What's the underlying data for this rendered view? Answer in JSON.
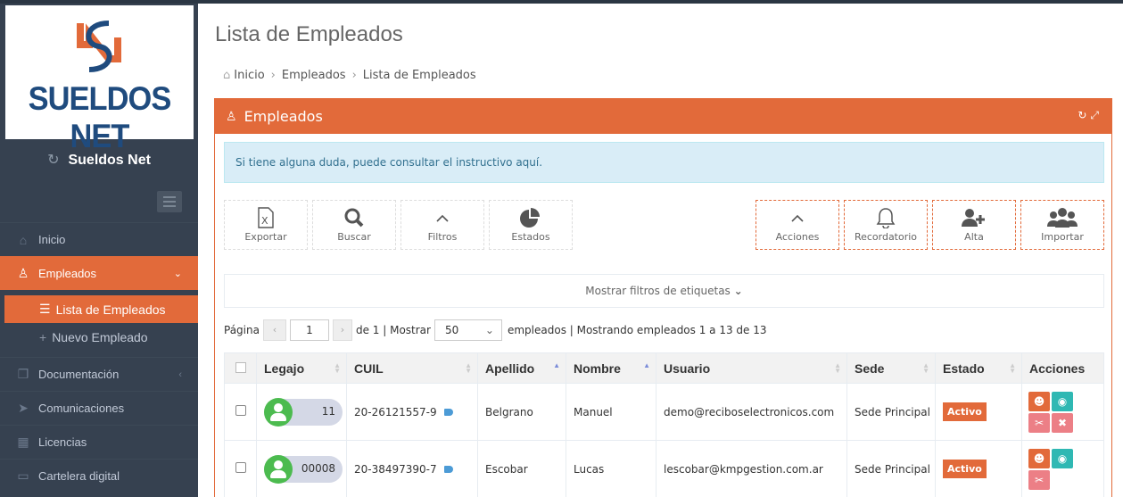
{
  "brand": {
    "logo_text": "SUELDOS NET",
    "app_name": "Sueldos Net"
  },
  "sidebar": {
    "items": [
      {
        "label": "Inicio",
        "icon": "home-icon"
      },
      {
        "label": "Empleados",
        "icon": "employees-icon"
      },
      {
        "label": "Documentación",
        "icon": "document-icon"
      },
      {
        "label": "Comunicaciones",
        "icon": "send-icon"
      },
      {
        "label": "Licencias",
        "icon": "calendar-icon"
      },
      {
        "label": "Cartelera digital",
        "icon": "board-icon"
      }
    ],
    "subitems": [
      {
        "label": "Lista de Empleados",
        "icon": "list-icon"
      },
      {
        "label": "Nuevo Empleado",
        "icon": "plus-icon"
      }
    ]
  },
  "page": {
    "title": "Lista de Empleados",
    "breadcrumb": [
      "Inicio",
      "Empleados",
      "Lista de Empleados"
    ]
  },
  "panel": {
    "title": "Empleados",
    "info": "Si tiene alguna duda, puede consultar el instructivo aquí.",
    "toolbar": [
      "Exportar",
      "Buscar",
      "Filtros",
      "Estados"
    ],
    "toolbar_right": [
      "Acciones",
      "Recordatorio",
      "Alta",
      "Importar"
    ],
    "tag_filter": "Mostrar filtros de etiquetas"
  },
  "pager": {
    "prefix": "Página",
    "page": "1",
    "of_text": "de 1 | Mostrar",
    "page_size": "50",
    "suffix": "empleados | Mostrando empleados 1 a 13 de 13"
  },
  "table": {
    "headers": [
      "Legajo",
      "CUIL",
      "Apellido",
      "Nombre",
      "Usuario",
      "Sede",
      "Estado",
      "Acciones"
    ],
    "rows": [
      {
        "legajo": "11",
        "cuil": "20-26121557-9",
        "apellido": "Belgrano",
        "nombre": "Manuel",
        "usuario": "demo@reciboselectronicos.com",
        "sede": "Sede Principal",
        "estado": "Activo"
      },
      {
        "legajo": "00008",
        "cuil": "20-38497390-7",
        "apellido": "Escobar",
        "nombre": "Lucas",
        "usuario": "lescobar@kmpgestion.com.ar",
        "sede": "Sede Principal",
        "estado": "Activo"
      }
    ]
  },
  "colors": {
    "accent": "#e26a3a",
    "sidebar": "#364150",
    "info_bg": "#d9edf7",
    "logo_blue": "#1f4b7e"
  }
}
